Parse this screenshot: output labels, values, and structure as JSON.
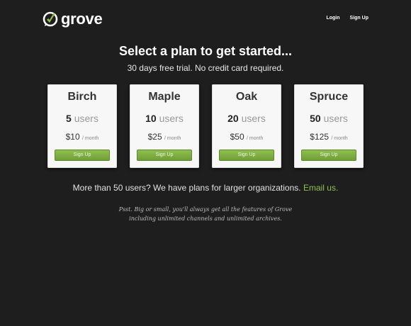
{
  "brand": {
    "name": "grove",
    "accent_color": "#8fc04f"
  },
  "nav": {
    "login": "Login",
    "signup": "Sign Up"
  },
  "hero": {
    "headline": "Select a plan to get started...",
    "subheadline": "30 days free trial. No credit card required."
  },
  "plans": [
    {
      "name": "Birch",
      "users_count": "5",
      "users_word": "users",
      "price": "$10",
      "period": "/ month",
      "button": "Sign Up"
    },
    {
      "name": "Maple",
      "users_count": "10",
      "users_word": "users",
      "price": "$25",
      "period": "/ month",
      "button": "Sign Up"
    },
    {
      "name": "Oak",
      "users_count": "20",
      "users_word": "users",
      "price": "$50",
      "period": "/ month",
      "button": "Sign Up"
    },
    {
      "name": "Spruce",
      "users_count": "50",
      "users_word": "users",
      "price": "$125",
      "period": "/ month",
      "button": "Sign Up"
    }
  ],
  "larger_orgs": {
    "text": "More than 50 users? We have plans for larger organizations.",
    "link": "Email us."
  },
  "footnote": {
    "line1": "Psst. Big or small, you'll always get all the features of Grove",
    "line2": "including unlimited channels and unlimited archives."
  }
}
